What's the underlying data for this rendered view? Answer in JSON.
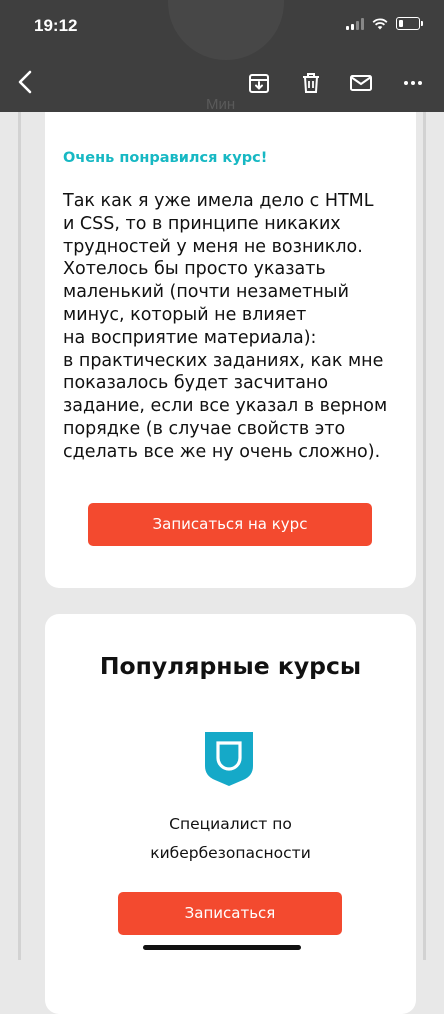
{
  "status_bar": {
    "time": "19:12"
  },
  "header": {
    "sender": "Мин",
    "icons": [
      "back-icon",
      "archive-icon",
      "trash-icon",
      "mail-icon",
      "more-icon"
    ]
  },
  "review": {
    "title": "Очень понравился курс!",
    "text": "Так как я уже имела дело с HTML\nи CSS, то в принципе никаких\nтрудностей у меня не возникло.\nХотелось бы просто указать\nмаленький (почти незаметный\nминус, который не влияет\nна восприятие материала):\nв практических заданиях, как мне\nпоказалось будет засчитано\nзадание, если все указал в верном\nпорядке (в случае свойств это\nсделать все же ну очень сложно).",
    "button_label": "Записаться на курс"
  },
  "popular": {
    "title": "Популярные курсы",
    "course_name": "Специалист по\nкибербезопасности",
    "button_label": "Записаться"
  },
  "colors": {
    "header_bg": "#3f3f3f",
    "accent_teal": "#17b8c3",
    "button_red": "#f34a2f",
    "page_bg": "#e8e8e8"
  }
}
